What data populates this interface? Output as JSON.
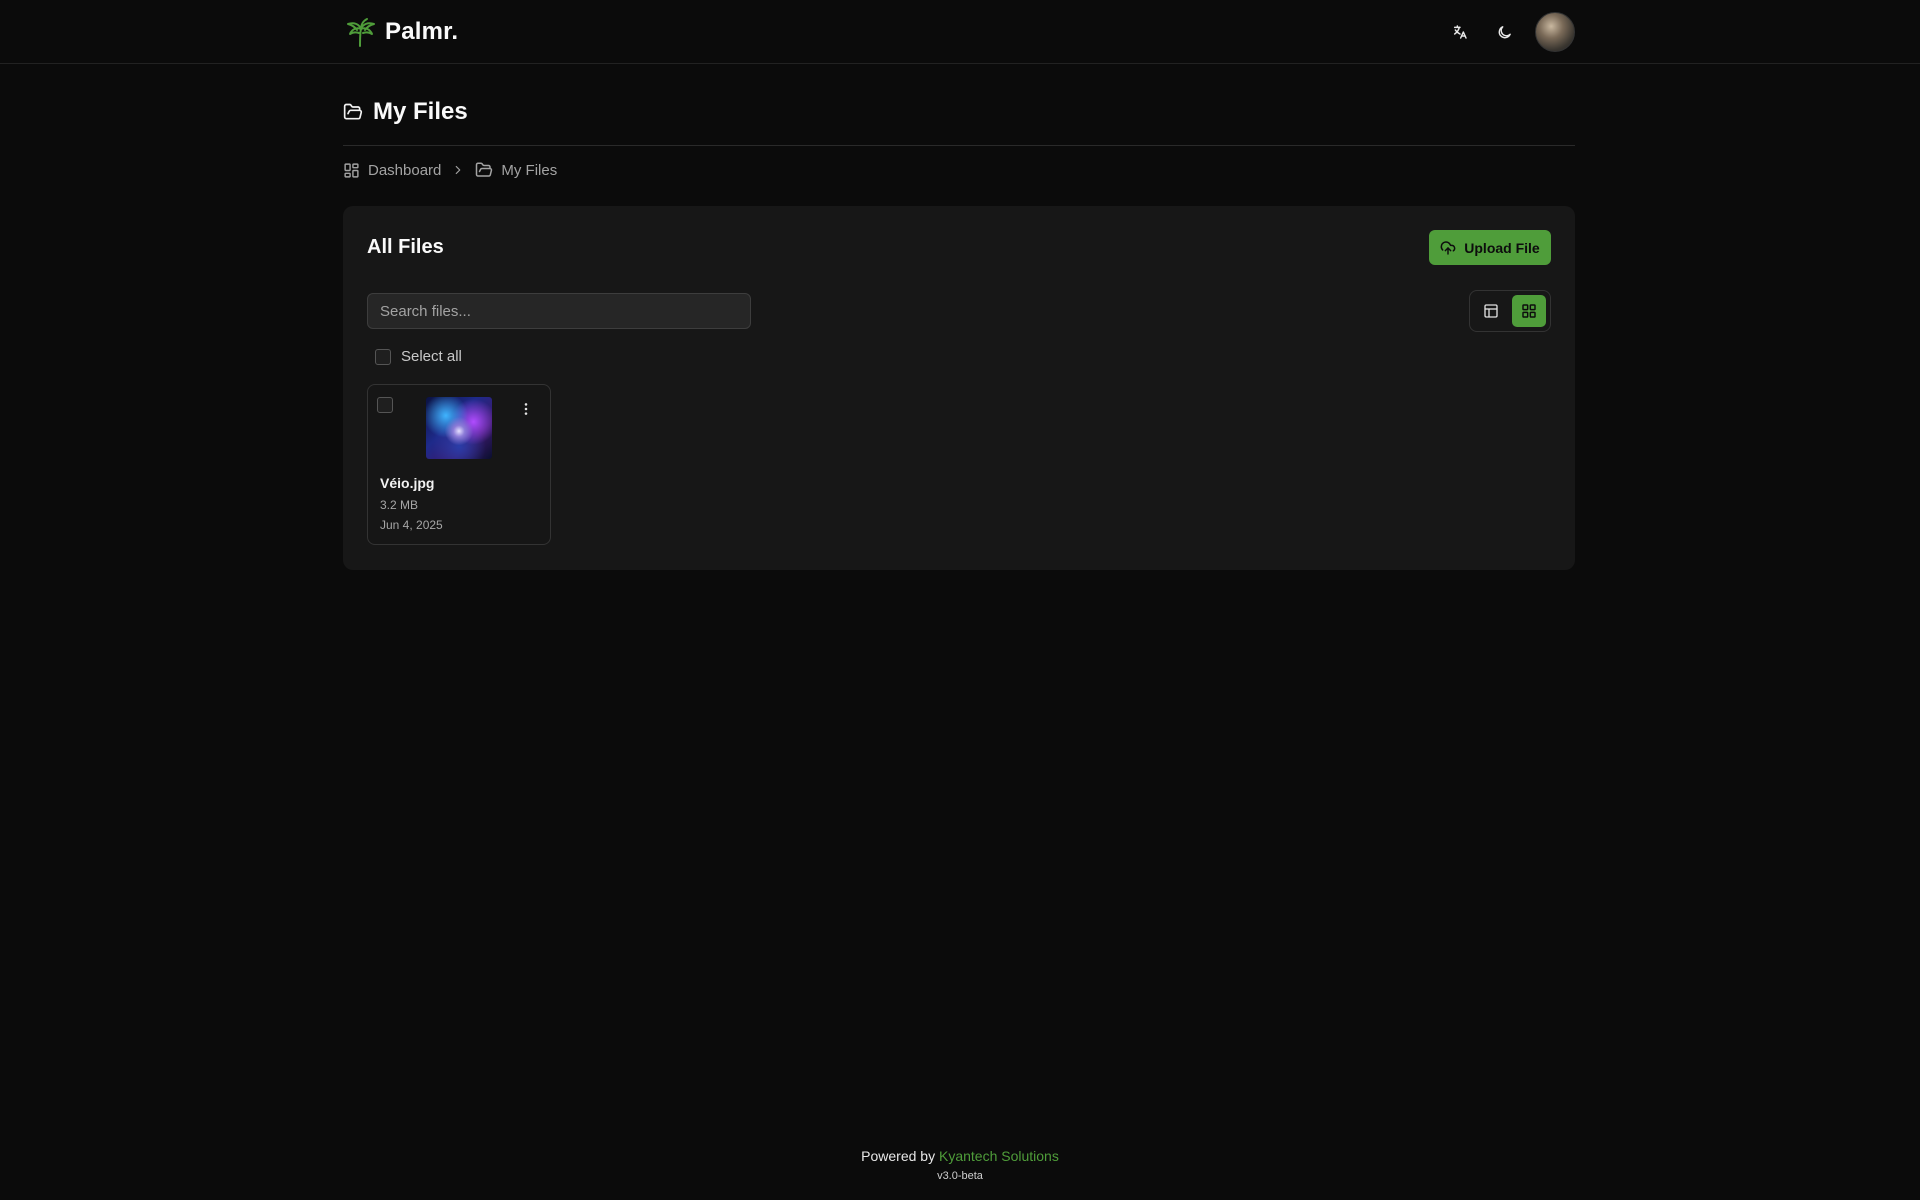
{
  "app": {
    "name": "Palmr.",
    "logo_icon": "palm-tree-icon",
    "brand_color": "#4f9d3a",
    "background": "#0b0b0b"
  },
  "header": {
    "language_icon": "translate-icon",
    "theme_icon": "moon-icon",
    "avatar_icon": "user-avatar"
  },
  "page": {
    "title": "My Files",
    "title_icon": "folder-open-icon"
  },
  "breadcrumb": [
    {
      "label": "Dashboard",
      "icon": "dashboard-grid-icon"
    },
    {
      "label": "My Files",
      "icon": "folder-open-icon"
    }
  ],
  "files_panel": {
    "title": "All Files",
    "upload_label": "Upload File",
    "upload_icon": "cloud-upload-icon",
    "search_placeholder": "Search files...",
    "search_value": "",
    "view_modes": [
      {
        "name": "table",
        "icon": "table-icon",
        "active": false
      },
      {
        "name": "grid",
        "icon": "grid-icon",
        "active": true
      }
    ],
    "select_all_label": "Select all",
    "files": [
      {
        "name": "Véio.jpg",
        "size": "3.2 MB",
        "date": "Jun 4, 2025",
        "menu_icon": "more-vertical-icon"
      }
    ]
  },
  "footer": {
    "powered_prefix": "Powered by",
    "powered_link": "Kyantech Solutions",
    "version": "v3.0-beta"
  }
}
